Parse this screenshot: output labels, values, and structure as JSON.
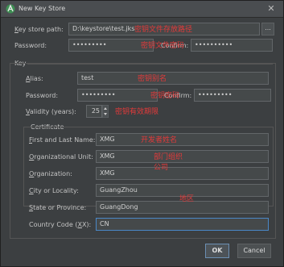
{
  "window": {
    "title": "New Key Store",
    "close_label": "✕"
  },
  "keystore": {
    "path_label_pre": "K",
    "path_label_rest": "ey store path:",
    "path_value": "D:\\keystore\\test.jks",
    "browse_label": "...",
    "password_label": "Password:",
    "password_value": "•••••••••",
    "confirm_label": "Confirm:",
    "confirm_value": "••••••••••"
  },
  "key": {
    "section_label": "Key",
    "alias_label_pre": "A",
    "alias_label_rest": "lias:",
    "alias_value": "test",
    "password_label": "Password:",
    "password_value": "•••••••••",
    "confirm_label": "Confirm:",
    "confirm_value": "•••••••••",
    "validity_label_pre": "V",
    "validity_label_rest": "alidity (years):",
    "validity_value": "25"
  },
  "certificate": {
    "section_label": "Certificate",
    "fields": [
      {
        "label_pre": "F",
        "label_rest": "irst and Last Name:",
        "value": "XMG"
      },
      {
        "label_pre": "O",
        "label_rest": "rganizational Unit:",
        "value": "XMG"
      },
      {
        "label_pre": "O",
        "label_rest": "rganization:",
        "value": "XMG"
      },
      {
        "label_pre": "C",
        "label_rest": "ity or Locality:",
        "value": "GuangZhou"
      },
      {
        "label_pre": "S",
        "label_rest": "tate or Province:",
        "value": "GuangDong"
      },
      {
        "label_pre": "Country Code (",
        "label_u": "X",
        "label_rest": "X):",
        "value": "CN"
      }
    ]
  },
  "buttons": {
    "ok": "OK",
    "cancel": "Cancel"
  },
  "annotations": {
    "path": "密钥文件存放路径",
    "store_password": "密钥文件密码",
    "alias": "密钥别名",
    "key_password": "密钥密码",
    "validity": "密钥有效期限",
    "name": "开发者姓名",
    "org_unit": "部门组织",
    "org": "公司",
    "region": "地区"
  },
  "colors": {
    "annotation": "#e23a3a",
    "focus": "#4a88c7"
  }
}
